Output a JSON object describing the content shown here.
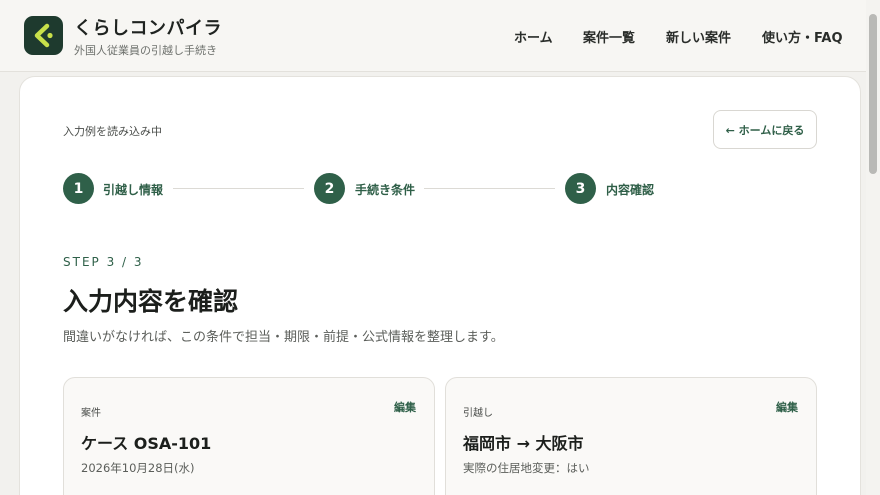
{
  "header": {
    "brand_name": "くらしコンパイラ",
    "brand_sub": "外国人従業員の引越し手続き",
    "nav": {
      "home": "ホーム",
      "cases": "案件一覧",
      "new_case": "新しい案件",
      "guide": "使い方・FAQ"
    }
  },
  "toolbar": {
    "loading_label": "入力例を読み込み中",
    "back_label": "← ホームに戻る"
  },
  "stepper": {
    "steps": [
      {
        "number": "1",
        "label": "引越し情報"
      },
      {
        "number": "2",
        "label": "手続き条件"
      },
      {
        "number": "3",
        "label": "内容確認"
      }
    ]
  },
  "main": {
    "step_eyebrow": "STEP 3 / 3",
    "title": "入力内容を確認",
    "description": "間違いがなければ、この条件で担当・期限・前提・公式情報を整理します。"
  },
  "panels": {
    "case": {
      "tag": "案件",
      "edit_label": "編集",
      "title": "ケース OSA-101",
      "subtitle": "2026年10月28日(水)"
    },
    "move": {
      "tag": "引越し",
      "edit_label": "編集",
      "title": "福岡市 → 大阪市",
      "subtitle": "実際の住居地変更：はい"
    }
  },
  "colors": {
    "accent": "#2f6049",
    "logo_bg": "#1e3a2e",
    "logo_mark": "#c8e04a"
  }
}
